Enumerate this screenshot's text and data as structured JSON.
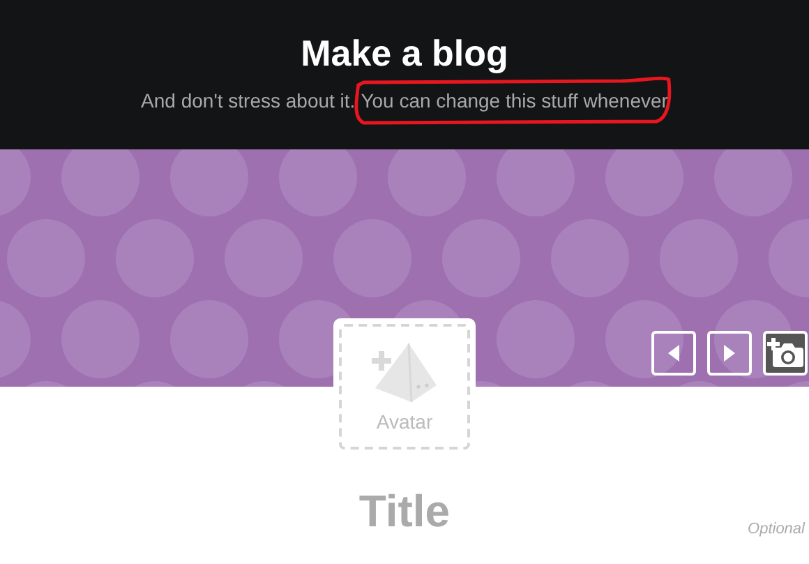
{
  "header": {
    "title": "Make a blog",
    "subtitle": [
      "And don't stress about it.",
      "You can change this stuff whenever"
    ],
    "annotation": {
      "kind": "loop",
      "color": "#e8161e"
    }
  },
  "avatar": {
    "label": "Avatar"
  },
  "title_field": {
    "placeholder": "Title",
    "note": "Optional"
  }
}
